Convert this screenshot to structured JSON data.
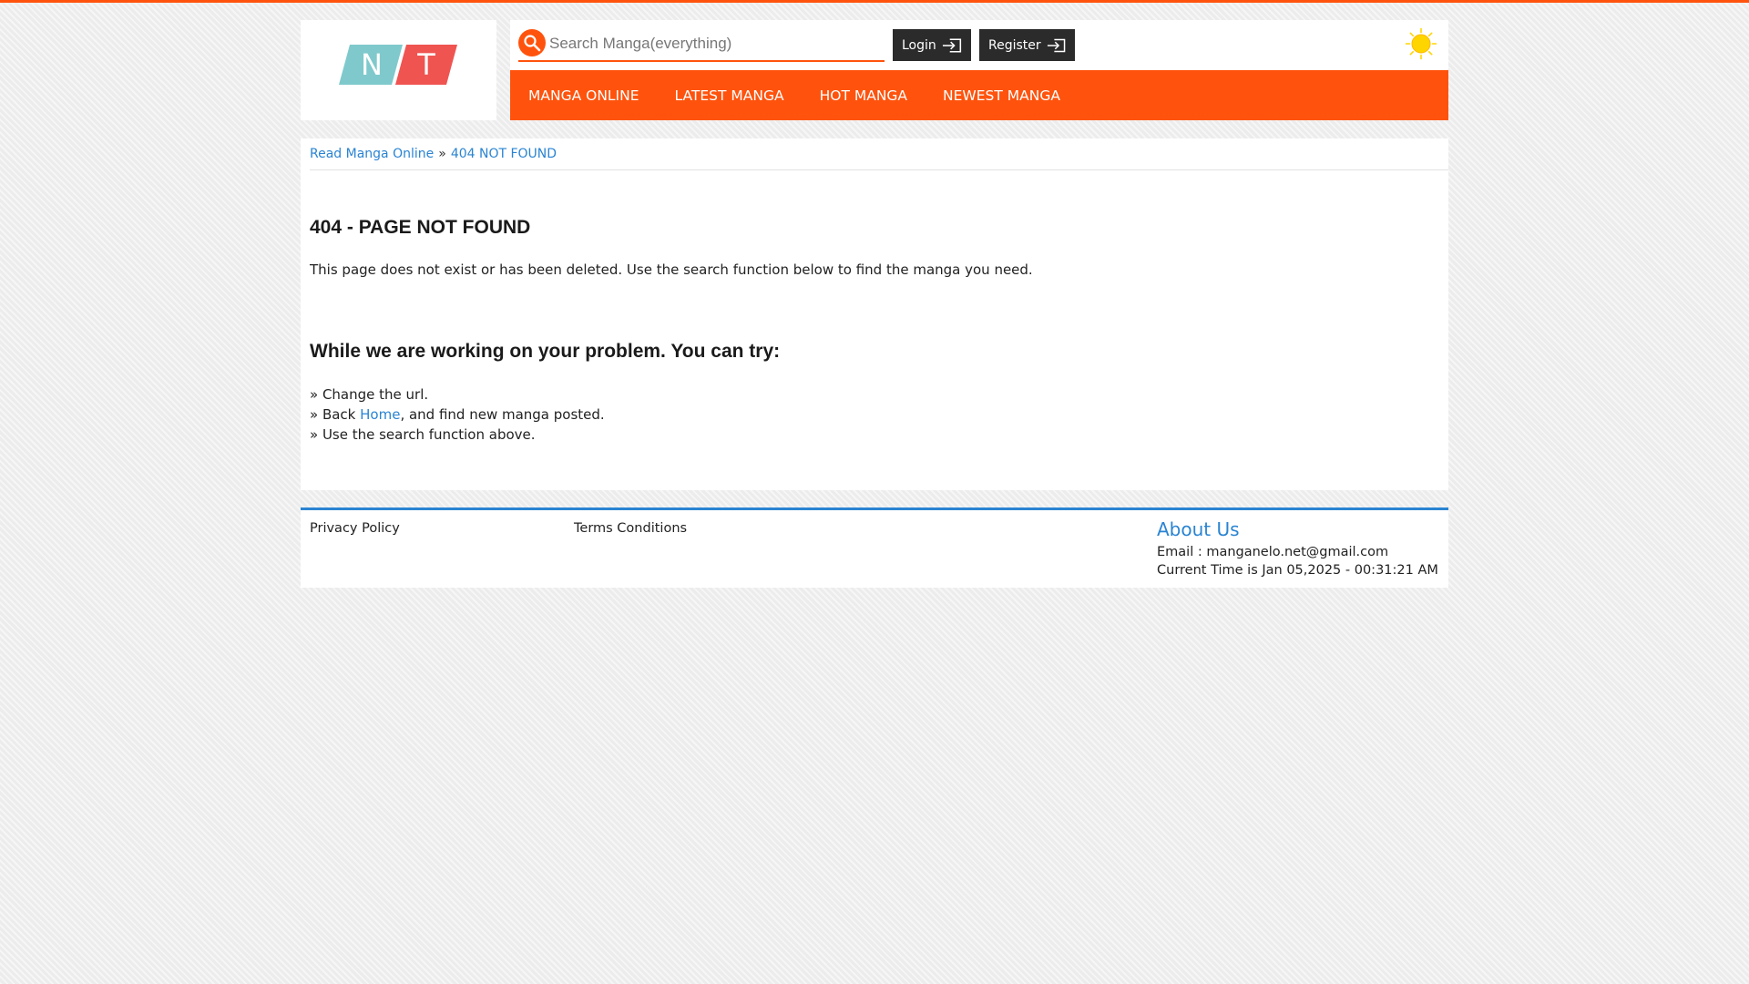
{
  "colors": {
    "accent": "#ff530d",
    "link": "#2a84d2",
    "logo_teal": "#7fc9cc",
    "logo_red": "#ef5451",
    "button_dark": "#2b2b2b",
    "sun": "#ffd500"
  },
  "logo": {
    "letters": [
      "N",
      "T"
    ]
  },
  "search": {
    "placeholder": "Search Manga(everything)",
    "value": "",
    "icon": "search-icon"
  },
  "auth": {
    "login_label": "Login",
    "register_label": "Register",
    "icon": "sign-in-icon"
  },
  "theme_toggle": {
    "icon": "sun-icon"
  },
  "nav": {
    "items": [
      {
        "label": "MANGA ONLINE"
      },
      {
        "label": "LATEST MANGA"
      },
      {
        "label": "HOT MANGA"
      },
      {
        "label": "NEWEST MANGA"
      }
    ]
  },
  "breadcrumb": {
    "home": "Read Manga Online",
    "separator": "»",
    "current": "404 NOT FOUND"
  },
  "main": {
    "title": "404 - PAGE NOT FOUND",
    "description": "This page does not exist or has been deleted. Use the search function below to find the manga you need.",
    "subtitle": "While we are working on your problem. You can try:",
    "tips": [
      {
        "prefix": "» Change the url.",
        "link": "",
        "suffix": ""
      },
      {
        "prefix": "» Back ",
        "link": "Home",
        "suffix": ", and find new manga posted."
      },
      {
        "prefix": "» Use the search function above.",
        "link": "",
        "suffix": ""
      }
    ]
  },
  "footer": {
    "privacy": "Privacy Policy",
    "terms": "Terms Conditions",
    "about_title": "About Us",
    "email_line": "Email : manganelo.net@gmail.com",
    "time_line": "Current Time is Jan 05,2025 - 00:31:21 AM"
  }
}
